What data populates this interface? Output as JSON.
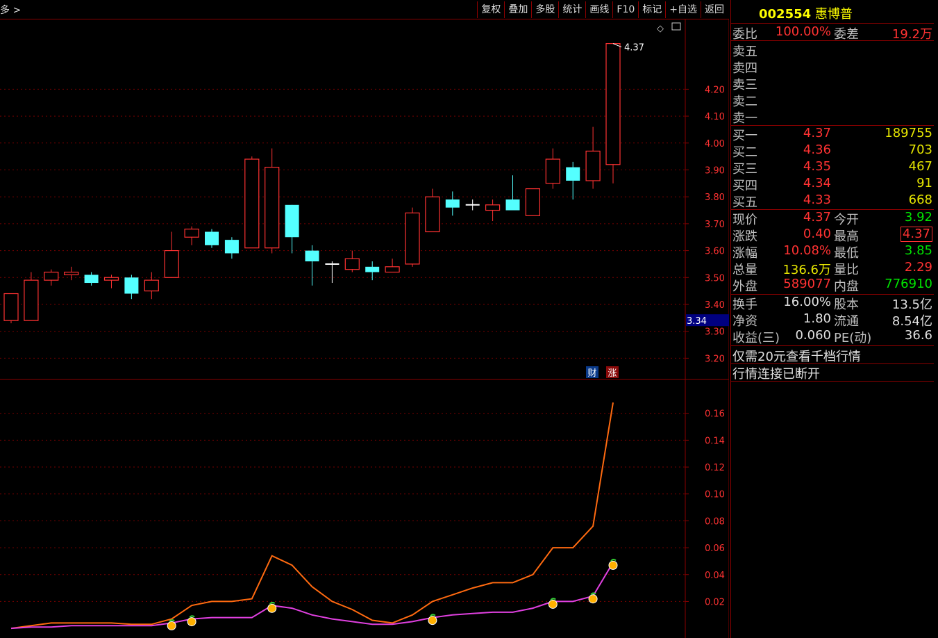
{
  "toolbar": {
    "left_label": "多 >",
    "buttons": [
      "复权",
      "叠加",
      "多股",
      "统计",
      "画线",
      "F10",
      "标记",
      "+自选",
      "返回"
    ]
  },
  "badges": {
    "fin": "财",
    "up": "涨"
  },
  "chart_data": [
    {
      "type": "candlestick",
      "price_axis_ticks": [
        "4.20",
        "4.10",
        "4.00",
        "3.90",
        "3.80",
        "3.70",
        "3.60",
        "3.50",
        "3.40",
        "3.30",
        "3.20"
      ],
      "ylim": [
        3.17,
        4.4
      ],
      "max_label": "4.37",
      "current_price_label": "3.34",
      "candles": [
        {
          "o": 3.34,
          "h": 3.43,
          "l": 3.33,
          "c": 3.44
        },
        {
          "o": 3.34,
          "h": 3.52,
          "l": 3.34,
          "c": 3.49
        },
        {
          "o": 3.49,
          "h": 3.53,
          "l": 3.47,
          "c": 3.52
        },
        {
          "o": 3.51,
          "h": 3.54,
          "l": 3.49,
          "c": 3.52
        },
        {
          "o": 3.51,
          "h": 3.52,
          "l": 3.47,
          "c": 3.48
        },
        {
          "o": 3.49,
          "h": 3.51,
          "l": 3.46,
          "c": 3.5
        },
        {
          "o": 3.5,
          "h": 3.51,
          "l": 3.42,
          "c": 3.44
        },
        {
          "o": 3.45,
          "h": 3.52,
          "l": 3.42,
          "c": 3.49
        },
        {
          "o": 3.5,
          "h": 3.67,
          "l": 3.5,
          "c": 3.6
        },
        {
          "o": 3.65,
          "h": 3.69,
          "l": 3.62,
          "c": 3.68
        },
        {
          "o": 3.67,
          "h": 3.68,
          "l": 3.61,
          "c": 3.62
        },
        {
          "o": 3.64,
          "h": 3.65,
          "l": 3.57,
          "c": 3.59
        },
        {
          "o": 3.61,
          "h": 3.95,
          "l": 3.61,
          "c": 3.94
        },
        {
          "o": 3.61,
          "h": 3.98,
          "l": 3.59,
          "c": 3.91
        },
        {
          "o": 3.77,
          "h": 3.77,
          "l": 3.59,
          "c": 3.65
        },
        {
          "o": 3.6,
          "h": 3.62,
          "l": 3.47,
          "c": 3.56
        },
        {
          "o": 3.55,
          "h": 3.56,
          "l": 3.48,
          "c": 3.55
        },
        {
          "o": 3.53,
          "h": 3.6,
          "l": 3.52,
          "c": 3.57
        },
        {
          "o": 3.54,
          "h": 3.56,
          "l": 3.49,
          "c": 3.52
        },
        {
          "o": 3.52,
          "h": 3.57,
          "l": 3.52,
          "c": 3.54
        },
        {
          "o": 3.55,
          "h": 3.76,
          "l": 3.54,
          "c": 3.74
        },
        {
          "o": 3.67,
          "h": 3.83,
          "l": 3.67,
          "c": 3.8
        },
        {
          "o": 3.79,
          "h": 3.82,
          "l": 3.73,
          "c": 3.76
        },
        {
          "o": 3.77,
          "h": 3.79,
          "l": 3.75,
          "c": 3.77
        },
        {
          "o": 3.75,
          "h": 3.79,
          "l": 3.71,
          "c": 3.77
        },
        {
          "o": 3.79,
          "h": 3.88,
          "l": 3.75,
          "c": 3.75
        },
        {
          "o": 3.73,
          "h": 3.83,
          "l": 3.73,
          "c": 3.83
        },
        {
          "o": 3.85,
          "h": 3.98,
          "l": 3.83,
          "c": 3.94
        },
        {
          "o": 3.91,
          "h": 3.93,
          "l": 3.79,
          "c": 3.86
        },
        {
          "o": 3.86,
          "h": 4.06,
          "l": 3.83,
          "c": 3.97
        },
        {
          "o": 3.92,
          "h": 4.37,
          "l": 3.85,
          "c": 4.37
        }
      ]
    },
    {
      "type": "line",
      "indicator_axis_ticks": [
        "0.16",
        "0.14",
        "0.12",
        "0.10",
        "0.08",
        "0.06",
        "0.04",
        "0.02"
      ],
      "ylim": [
        -0.0015,
        0.1795
      ],
      "series": [
        {
          "color": "#ff6a10",
          "values": [
            0.0,
            0.002,
            0.004,
            0.004,
            0.004,
            0.004,
            0.003,
            0.003,
            0.007,
            0.017,
            0.02,
            0.02,
            0.022,
            0.054,
            0.047,
            0.031,
            0.02,
            0.014,
            0.006,
            0.004,
            0.01,
            0.02,
            0.025,
            0.03,
            0.034,
            0.034,
            0.04,
            0.06,
            0.06,
            0.076,
            0.168
          ]
        },
        {
          "color": "#e040e0",
          "values": [
            0.0,
            0.001,
            0.001,
            0.002,
            0.002,
            0.002,
            0.002,
            0.002,
            0.004,
            0.007,
            0.008,
            0.008,
            0.008,
            0.017,
            0.015,
            0.01,
            0.007,
            0.005,
            0.003,
            0.003,
            0.005,
            0.008,
            0.01,
            0.011,
            0.012,
            0.012,
            0.015,
            0.02,
            0.02,
            0.024,
            0.049
          ]
        }
      ],
      "markers_at_indices": [
        8,
        9,
        13,
        21,
        27,
        29,
        30
      ]
    }
  ],
  "quote_panel": {
    "code": "002554",
    "name": "惠博普",
    "weibi_label": "委比",
    "weibi": "100.00%",
    "weicha_label": "委差",
    "weicha": "19.2万",
    "sells": [
      {
        "label": "卖五"
      },
      {
        "label": "卖四"
      },
      {
        "label": "卖三"
      },
      {
        "label": "卖二"
      },
      {
        "label": "卖一"
      }
    ],
    "buys": [
      {
        "label": "买一",
        "price": "4.37",
        "vol": "189755"
      },
      {
        "label": "买二",
        "price": "4.36",
        "vol": "703"
      },
      {
        "label": "买三",
        "price": "4.35",
        "vol": "467"
      },
      {
        "label": "买四",
        "price": "4.34",
        "vol": "91"
      },
      {
        "label": "买五",
        "price": "4.33",
        "vol": "668"
      }
    ],
    "stats": [
      {
        "l1": "现价",
        "v1": "4.37",
        "c1": "red",
        "l2": "今开",
        "v2": "3.92",
        "c2": "green"
      },
      {
        "l1": "涨跌",
        "v1": "0.40",
        "c1": "red",
        "l2": "最高",
        "v2": "4.37",
        "c2": "red"
      },
      {
        "l1": "涨幅",
        "v1": "10.08%",
        "c1": "red",
        "l2": "最低",
        "v2": "3.85",
        "c2": "green"
      },
      {
        "l1": "总量",
        "v1": "136.6万",
        "c1": "yellow",
        "l2": "量比",
        "v2": "2.29",
        "c2": "red"
      },
      {
        "l1": "外盘",
        "v1": "589077",
        "c1": "red",
        "l2": "内盘",
        "v2": "776910",
        "c2": "green"
      }
    ],
    "stats2": [
      {
        "l1": "换手",
        "v1": "16.00%",
        "l2": "股本",
        "v2": "13.5亿"
      },
      {
        "l1": "净资",
        "v1": "1.80",
        "l2": "流通",
        "v2": "8.54亿"
      },
      {
        "l1": "收益(三)",
        "v1": "0.060",
        "l2": "PE(动)",
        "v2": "36.6"
      }
    ],
    "promo": "仅需20元查看千档行情",
    "status": "行情连接已断开"
  }
}
